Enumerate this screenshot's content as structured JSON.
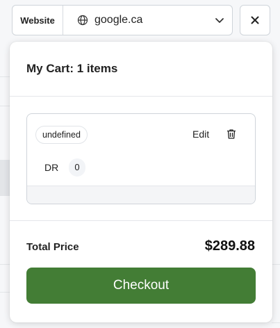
{
  "header": {
    "site_label": "Website",
    "site_value": "google.ca",
    "globe_icon": "globe-icon",
    "dropdown_icon": "chevron-down-icon",
    "close_icon": "close-icon"
  },
  "cart": {
    "title": "My Cart: 1 items",
    "items": [
      {
        "tag": "undefined",
        "edit_label": "Edit",
        "delete_icon": "trash-icon",
        "metric_label": "DR",
        "metric_value": "0"
      }
    ],
    "total_label": "Total Price",
    "total_value": "$289.88",
    "checkout_label": "Checkout"
  },
  "colors": {
    "checkout_green": "#437d35",
    "border": "#cfd4da"
  }
}
